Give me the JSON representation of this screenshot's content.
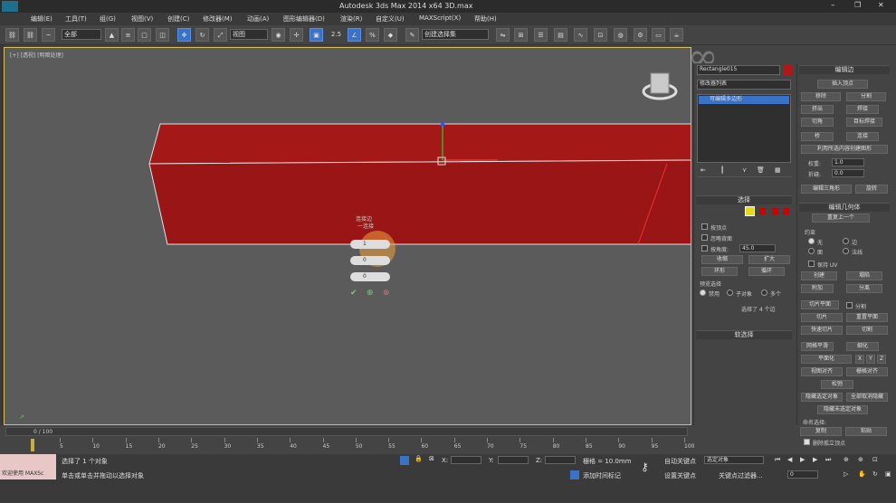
{
  "window": {
    "title": "Autodesk 3ds Max  2014 x64     3D.max"
  },
  "menu": [
    "编辑(E)",
    "工具(T)",
    "组(G)",
    "视图(V)",
    "创建(C)",
    "修改器(M)",
    "动画(A)",
    "图形编辑器(D)",
    "渲染(R)",
    "自定义(U)",
    "MAXScript(X)",
    "帮助(H)"
  ],
  "toolbar": {
    "filter": "全部",
    "refcoord": "视图",
    "snap_label": "2.5",
    "named_sel": "创建选择集"
  },
  "viewport": {
    "label": "[+] [透视] [明暗处理]"
  },
  "caddy": {
    "title": "连接边",
    "subtitle": "一连接",
    "field1": "1",
    "field2": "0",
    "field3": "0"
  },
  "modpanel": {
    "object_name": "Rectangle015",
    "modifier_list": "修改器列表",
    "stack_item": "可编辑多边形",
    "selection_header": "选择",
    "by_vertex": "按顶点",
    "ignore_backfacing": "忽略背面",
    "by_angle": "按角度:",
    "angle_value": "45.0",
    "shrink": "收缩",
    "grow": "扩大",
    "ring": "环形",
    "loop": "循环",
    "preview_header": "预览选择",
    "preview_off": "禁用",
    "preview_subobj": "子对象",
    "preview_multi": "多个",
    "status": "选择了 4 个边",
    "soft_select": "软选择"
  },
  "editedges": {
    "header": "编辑边",
    "insert_vertex": "插入顶点",
    "remove": "移除",
    "split": "分割",
    "extrude": "挤出",
    "weld": "焊接",
    "chamfer": "切角",
    "target_weld": "目标焊接",
    "bridge": "桥",
    "connect": "连接",
    "create_shape": "利用所选内容创建图形",
    "weight_label": "权重:",
    "weight_value": "1.0",
    "crease_label": "折缝:",
    "crease_value": "0.0",
    "edit_tri": "编辑三角形",
    "turn": "旋转",
    "geom_header": "编辑几何体",
    "repeat_last": "重复上一个",
    "constraints": "约束",
    "c_none": "无",
    "c_edge": "边",
    "c_face": "面",
    "c_normal": "法线",
    "preserve_uv": "保持 UV",
    "create": "创建",
    "collapse": "塌陷",
    "attach": "附加",
    "detach": "分离",
    "slice_plane": "切片平面",
    "split2": "分割",
    "slice": "切片",
    "reset_plane": "重置平面",
    "quickslice": "快速切片",
    "cut": "切割",
    "msmooth": "网格平滑",
    "tessellate": "细化",
    "make_planar": "平面化",
    "x": "X",
    "y": "Y",
    "z": "Z",
    "view_align": "视图对齐",
    "grid_align": "栅格对齐",
    "relax": "松弛",
    "hide_sel": "隐藏选定对象",
    "unhide_all": "全部取消隐藏",
    "hide_unsel": "隐藏未选定对象",
    "named_sel": "命名选择:",
    "copy": "复制",
    "paste": "粘贴",
    "delete_iso": "删除孤立顶点"
  },
  "timeline": {
    "frame": "0 / 100",
    "ticks": [
      "5",
      "10",
      "15",
      "20",
      "25",
      "30",
      "35",
      "40",
      "45",
      "50",
      "55",
      "60",
      "65",
      "70",
      "75",
      "80",
      "85",
      "90",
      "95",
      "100"
    ]
  },
  "status": {
    "welcome": "欢迎使用 MAXSc",
    "sel": "选择了 1 个对象",
    "prompt": "单击或单击并拖动以选择对象",
    "x_label": "X:",
    "y_label": "Y:",
    "z_label": "Z:",
    "grid": "栅格 = 10.0mm",
    "add_time_tag": "添加时间标记",
    "auto_key": "自动关键点",
    "set_key": "设置关键点",
    "sel_obj": "选定对象",
    "key_filter": "关键点过滤器...",
    "frame_field": "0"
  },
  "colors": {
    "accent": "#3a72c8",
    "object": "#b01818",
    "viewport_border": "#d8c060"
  }
}
